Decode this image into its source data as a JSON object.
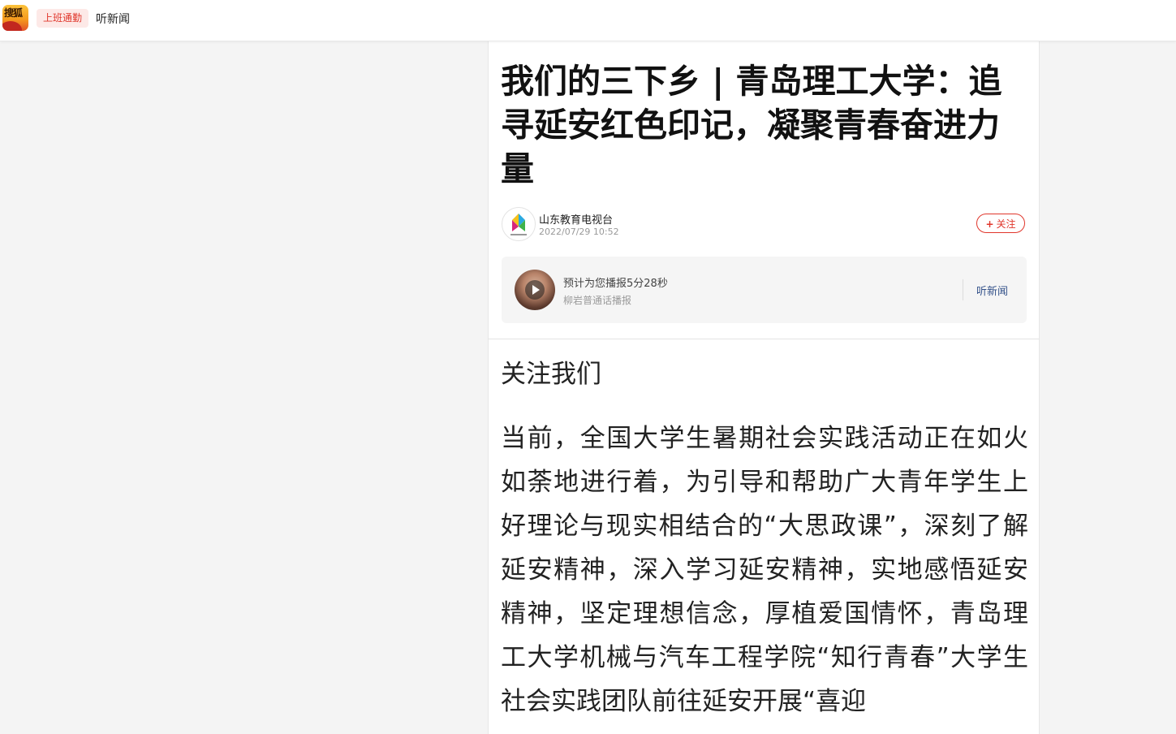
{
  "topbar": {
    "logo_text": "搜狐",
    "mode_tag": "上班通勤",
    "listen_label": "听新闻"
  },
  "article": {
    "title": "我们的三下乡 | 青岛理工大学：追寻延安红色印记，凝聚青春奋进力量",
    "author": {
      "name": "山东教育电视台",
      "time": "2022/07/29 10:52"
    },
    "follow_button": {
      "icon": "+",
      "label": "关注"
    },
    "audio": {
      "estimate": "预计为您播报5分28秒",
      "voice": "柳岩普通话播报",
      "listen_label": "听新闻"
    },
    "follow_us": "关注我们",
    "body": "当前，全国大学生暑期社会实践活动正在如火如荼地进行着，为引导和帮助广大青年学生上好理论与现实相结合的“大思政课”，深刻了解延安精神，深入学习延安精神，实地感悟延安精神，坚定理想信念，厚植爱国情怀，青岛理工大学机械与汽车工程学院“知行青春”大学生社会实践团队前往延安开展“喜迎"
  },
  "colors": {
    "accent_red": "#e0362b",
    "tag_bg": "#fde9e7",
    "link_blue": "#34528a"
  }
}
